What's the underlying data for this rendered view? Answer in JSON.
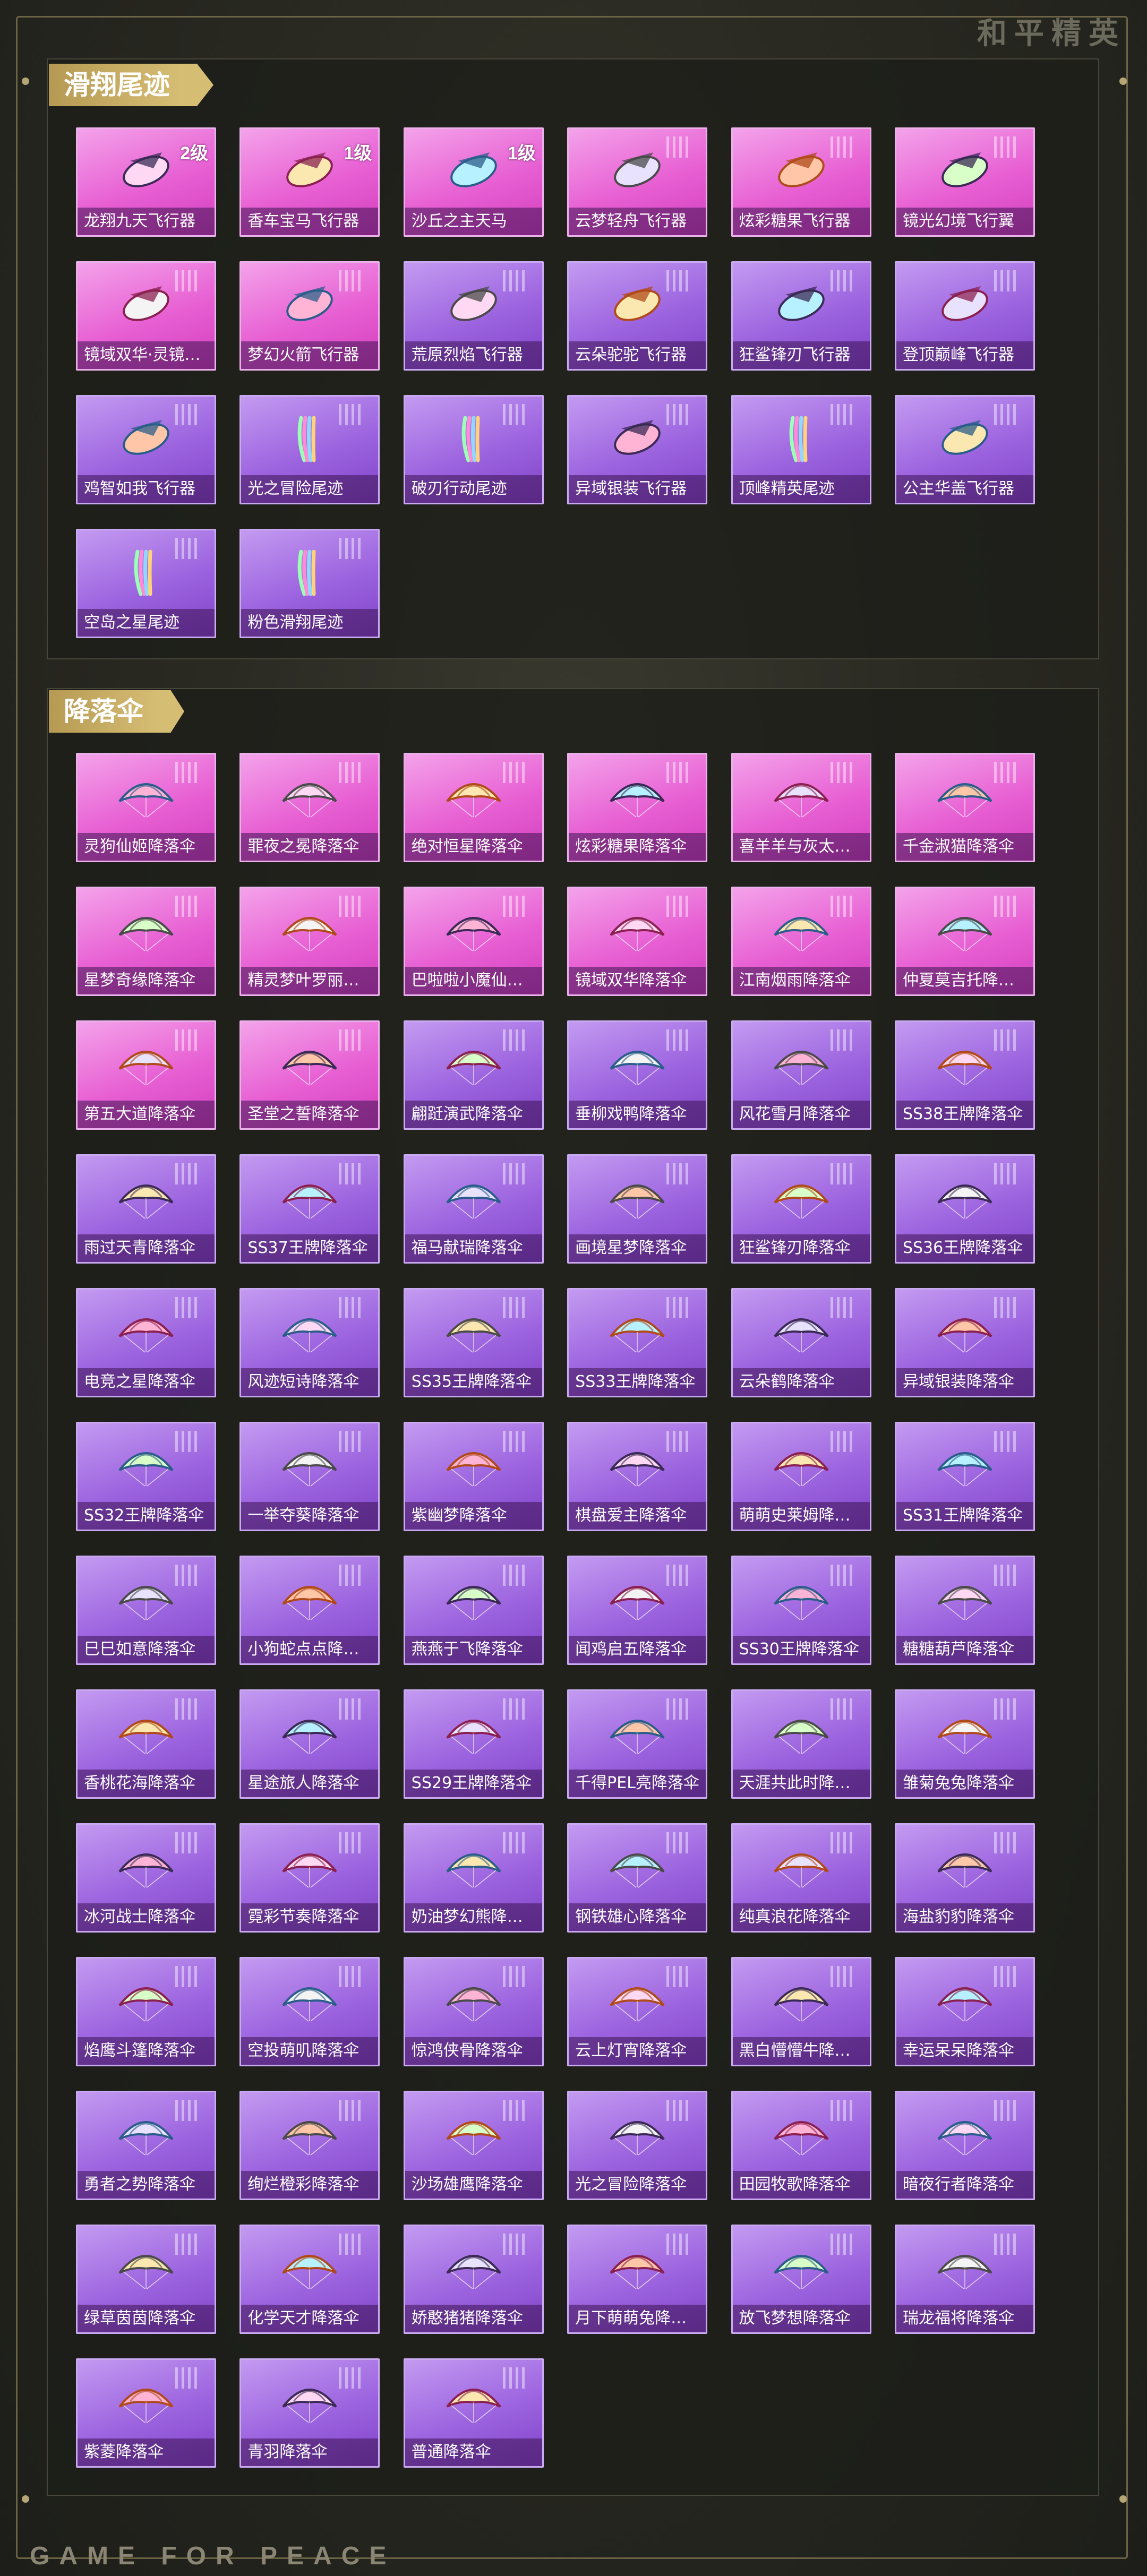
{
  "brand": {
    "logo_text": "和平精英",
    "footer_text": "GAME FOR PEACE"
  },
  "colors": {
    "card_pink": "#e75fd3",
    "card_purple": "#9c63df",
    "tag_gold": "#c9ad64"
  },
  "sections": [
    {
      "title": "滑翔尾迹",
      "items": [
        {
          "label": "龙翔九天飞行器",
          "badge": "2级",
          "rarity": "pink",
          "icon": "dragon-glider-icon"
        },
        {
          "label": "香车宝马飞行器",
          "badge": "1级",
          "rarity": "pink",
          "icon": "horse-glider-icon"
        },
        {
          "label": "沙丘之主天马",
          "badge": "1级",
          "rarity": "pink",
          "icon": "pegasus-glider-icon"
        },
        {
          "label": "云梦轻舟飞行器",
          "badge": "",
          "rarity": "pink",
          "icon": "boat-glider-icon"
        },
        {
          "label": "炫彩糖果飞行器",
          "badge": "",
          "rarity": "pink",
          "icon": "candy-glider-icon"
        },
        {
          "label": "镜光幻境飞行翼",
          "badge": "",
          "rarity": "pink",
          "icon": "wing-glider-icon"
        },
        {
          "label": "镜域双华·灵镜…",
          "badge": "",
          "rarity": "pink",
          "icon": "twin-glider-icon"
        },
        {
          "label": "梦幻火箭飞行器",
          "badge": "",
          "rarity": "pink",
          "icon": "rocket-glider-icon"
        },
        {
          "label": "荒原烈焰飞行器",
          "badge": "",
          "rarity": "purple",
          "icon": "flame-glider-icon"
        },
        {
          "label": "云朵驼驼飞行器",
          "badge": "",
          "rarity": "purple",
          "icon": "alpaca-glider-icon"
        },
        {
          "label": "狂鲨锋刃飞行器",
          "badge": "",
          "rarity": "purple",
          "icon": "shark-glider-icon"
        },
        {
          "label": "登顶巅峰飞行器",
          "badge": "",
          "rarity": "purple",
          "icon": "summit-glider-icon"
        },
        {
          "label": "鸡智如我飞行器",
          "badge": "",
          "rarity": "purple",
          "icon": "chicken-glider-icon"
        },
        {
          "label": "光之冒险尾迹",
          "badge": "",
          "rarity": "purple",
          "icon": "trail-icon"
        },
        {
          "label": "破刃行动尾迹",
          "badge": "",
          "rarity": "purple",
          "icon": "trail-icon"
        },
        {
          "label": "异域银装飞行器",
          "badge": "",
          "rarity": "purple",
          "icon": "exotic-glider-icon"
        },
        {
          "label": "顶峰精英尾迹",
          "badge": "",
          "rarity": "purple",
          "icon": "trail-icon"
        },
        {
          "label": "公主华盖飞行器",
          "badge": "",
          "rarity": "purple",
          "icon": "princess-glider-icon"
        },
        {
          "label": "空岛之星尾迹",
          "badge": "",
          "rarity": "purple",
          "icon": "trail-icon"
        },
        {
          "label": "粉色滑翔尾迹",
          "badge": "",
          "rarity": "purple",
          "icon": "trail-icon"
        }
      ]
    },
    {
      "title": "降落伞",
      "items": [
        {
          "label": "灵狗仙姬降落伞",
          "rarity": "pink",
          "icon": "parachute-icon"
        },
        {
          "label": "罪夜之冕降落伞",
          "rarity": "pink",
          "icon": "parachute-icon"
        },
        {
          "label": "绝对恒星降落伞",
          "rarity": "pink",
          "icon": "parachute-icon"
        },
        {
          "label": "炫彩糖果降落伞",
          "rarity": "pink",
          "icon": "parachute-icon"
        },
        {
          "label": "喜羊羊与灰太…",
          "rarity": "pink",
          "icon": "parachute-icon"
        },
        {
          "label": "千金淑猫降落伞",
          "rarity": "pink",
          "icon": "parachute-icon"
        },
        {
          "label": "星梦奇缘降落伞",
          "rarity": "pink",
          "icon": "parachute-icon"
        },
        {
          "label": "精灵梦叶罗丽…",
          "rarity": "pink",
          "icon": "parachute-icon"
        },
        {
          "label": "巴啦啦小魔仙…",
          "rarity": "pink",
          "icon": "parachute-icon"
        },
        {
          "label": "镜域双华降落伞",
          "rarity": "pink",
          "icon": "parachute-icon"
        },
        {
          "label": "江南烟雨降落伞",
          "rarity": "pink",
          "icon": "parachute-icon"
        },
        {
          "label": "仲夏莫吉托降…",
          "rarity": "pink",
          "icon": "parachute-icon"
        },
        {
          "label": "第五大道降落伞",
          "rarity": "pink",
          "icon": "parachute-icon"
        },
        {
          "label": "圣堂之誓降落伞",
          "rarity": "pink",
          "icon": "parachute-icon"
        },
        {
          "label": "翩跹演武降落伞",
          "rarity": "purple",
          "icon": "parachute-icon"
        },
        {
          "label": "垂柳戏鸭降落伞",
          "rarity": "purple",
          "icon": "parachute-icon"
        },
        {
          "label": "风花雪月降落伞",
          "rarity": "purple",
          "icon": "parachute-icon"
        },
        {
          "label": "SS38王牌降落伞",
          "rarity": "purple",
          "icon": "parachute-icon"
        },
        {
          "label": "雨过天青降落伞",
          "rarity": "purple",
          "icon": "parachute-icon"
        },
        {
          "label": "SS37王牌降落伞",
          "rarity": "purple",
          "icon": "parachute-icon"
        },
        {
          "label": "福马献瑞降落伞",
          "rarity": "purple",
          "icon": "parachute-icon"
        },
        {
          "label": "画境星梦降落伞",
          "rarity": "purple",
          "icon": "parachute-icon"
        },
        {
          "label": "狂鲨锋刃降落伞",
          "rarity": "purple",
          "icon": "parachute-icon"
        },
        {
          "label": "SS36王牌降落伞",
          "rarity": "purple",
          "icon": "parachute-icon"
        },
        {
          "label": "电竞之星降落伞",
          "rarity": "purple",
          "icon": "parachute-icon"
        },
        {
          "label": "风迹短诗降落伞",
          "rarity": "purple",
          "icon": "parachute-icon"
        },
        {
          "label": "SS35王牌降落伞",
          "rarity": "purple",
          "icon": "parachute-icon"
        },
        {
          "label": "SS33王牌降落伞",
          "rarity": "purple",
          "icon": "parachute-icon"
        },
        {
          "label": "云朵鹤降落伞",
          "rarity": "purple",
          "icon": "parachute-icon"
        },
        {
          "label": "异域银装降落伞",
          "rarity": "purple",
          "icon": "parachute-icon"
        },
        {
          "label": "SS32王牌降落伞",
          "rarity": "purple",
          "icon": "parachute-icon"
        },
        {
          "label": "一举夺葵降落伞",
          "rarity": "purple",
          "icon": "parachute-icon"
        },
        {
          "label": "紫幽梦降落伞",
          "rarity": "purple",
          "icon": "parachute-icon"
        },
        {
          "label": "棋盘爱主降落伞",
          "rarity": "purple",
          "icon": "parachute-icon"
        },
        {
          "label": "萌萌史莱姆降…",
          "rarity": "purple",
          "icon": "parachute-icon"
        },
        {
          "label": "SS31王牌降落伞",
          "rarity": "purple",
          "icon": "parachute-icon"
        },
        {
          "label": "巳巳如意降落伞",
          "rarity": "purple",
          "icon": "parachute-icon"
        },
        {
          "label": "小狗蛇点点降…",
          "rarity": "purple",
          "icon": "parachute-icon"
        },
        {
          "label": "燕燕于飞降落伞",
          "rarity": "purple",
          "icon": "parachute-icon"
        },
        {
          "label": "闻鸡启五降落伞",
          "rarity": "purple",
          "icon": "parachute-icon"
        },
        {
          "label": "SS30王牌降落伞",
          "rarity": "purple",
          "icon": "parachute-icon"
        },
        {
          "label": "糖糖葫芦降落伞",
          "rarity": "purple",
          "icon": "parachute-icon"
        },
        {
          "label": "香桃花海降落伞",
          "rarity": "purple",
          "icon": "parachute-icon"
        },
        {
          "label": "星途旅人降落伞",
          "rarity": "purple",
          "icon": "parachute-icon"
        },
        {
          "label": "SS29王牌降落伞",
          "rarity": "purple",
          "icon": "parachute-icon"
        },
        {
          "label": "千得PEL亮降落伞",
          "rarity": "purple",
          "icon": "parachute-icon"
        },
        {
          "label": "天涯共此时降…",
          "rarity": "purple",
          "icon": "parachute-icon"
        },
        {
          "label": "雏菊兔兔降落伞",
          "rarity": "purple",
          "icon": "parachute-icon"
        },
        {
          "label": "冰河战士降落伞",
          "rarity": "purple",
          "icon": "parachute-icon"
        },
        {
          "label": "霓彩节奏降落伞",
          "rarity": "purple",
          "icon": "parachute-icon"
        },
        {
          "label": "奶油梦幻熊降…",
          "rarity": "purple",
          "icon": "parachute-icon"
        },
        {
          "label": "钢铁雄心降落伞",
          "rarity": "purple",
          "icon": "parachute-icon"
        },
        {
          "label": "纯真浪花降落伞",
          "rarity": "purple",
          "icon": "parachute-icon"
        },
        {
          "label": "海盐豹豹降落伞",
          "rarity": "purple",
          "icon": "parachute-icon"
        },
        {
          "label": "焰鹰斗篷降落伞",
          "rarity": "purple",
          "icon": "parachute-icon"
        },
        {
          "label": "空投萌叽降落伞",
          "rarity": "purple",
          "icon": "parachute-icon"
        },
        {
          "label": "惊鸿侠骨降落伞",
          "rarity": "purple",
          "icon": "parachute-icon"
        },
        {
          "label": "云上灯宵降落伞",
          "rarity": "purple",
          "icon": "parachute-icon"
        },
        {
          "label": "黑白懵懵牛降…",
          "rarity": "purple",
          "icon": "parachute-icon"
        },
        {
          "label": "幸运呆呆降落伞",
          "rarity": "purple",
          "icon": "parachute-icon"
        },
        {
          "label": "勇者之势降落伞",
          "rarity": "purple",
          "icon": "parachute-icon"
        },
        {
          "label": "绚烂橙彩降落伞",
          "rarity": "purple",
          "icon": "parachute-icon"
        },
        {
          "label": "沙场雄鹰降落伞",
          "rarity": "purple",
          "icon": "parachute-icon"
        },
        {
          "label": "光之冒险降落伞",
          "rarity": "purple",
          "icon": "parachute-icon"
        },
        {
          "label": "田园牧歌降落伞",
          "rarity": "purple",
          "icon": "parachute-icon"
        },
        {
          "label": "暗夜行者降落伞",
          "rarity": "purple",
          "icon": "parachute-icon"
        },
        {
          "label": "绿草茵茵降落伞",
          "rarity": "purple",
          "icon": "parachute-icon"
        },
        {
          "label": "化学天才降落伞",
          "rarity": "purple",
          "icon": "parachute-icon"
        },
        {
          "label": "娇憨猪猪降落伞",
          "rarity": "purple",
          "icon": "parachute-icon"
        },
        {
          "label": "月下萌萌兔降…",
          "rarity": "purple",
          "icon": "parachute-icon"
        },
        {
          "label": "放飞梦想降落伞",
          "rarity": "purple",
          "icon": "parachute-icon"
        },
        {
          "label": "瑞龙福将降落伞",
          "rarity": "purple",
          "icon": "parachute-icon"
        },
        {
          "label": "紫菱降落伞",
          "rarity": "purple",
          "icon": "parachute-icon"
        },
        {
          "label": "青羽降落伞",
          "rarity": "purple",
          "icon": "parachute-icon"
        },
        {
          "label": "普通降落伞",
          "rarity": "purple",
          "icon": "parachute-icon"
        }
      ]
    }
  ]
}
